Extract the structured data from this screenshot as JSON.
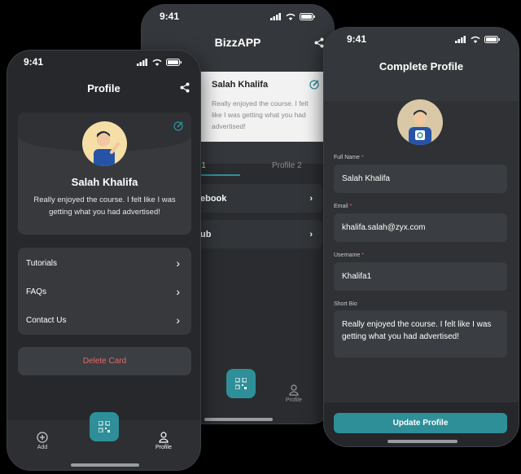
{
  "phone_left": {
    "time": "9:41",
    "title": "Profile",
    "name": "Salah Khalifa",
    "bio": "Really enjoyed the course. I felt like I was getting what you had advertised!",
    "menu": [
      "Tutorials",
      "FAQs",
      "Contact Us"
    ],
    "delete_label": "Delete Card",
    "nav_add": "Add",
    "nav_profile": "Profile"
  },
  "phone_middle": {
    "time": "9:41",
    "title": "BizzAPP",
    "card_name": "Salah Khalifa",
    "card_bio": "Really enjoyed the course. I felt like I was getting what you had advertised!",
    "tab1": "e 1",
    "tab2": "Profile 2",
    "row1": "ebook",
    "row2": "ub",
    "nav_profile": "Profile"
  },
  "phone_right": {
    "time": "9:41",
    "title": "Complete Profile",
    "fields": {
      "full_name_label": "Full Name",
      "full_name": "Salah Khalifa",
      "email_label": "Email",
      "email": "khalifa.salah@zyx.com",
      "username_label": "Username",
      "username": "Khalifa1",
      "bio_label": "Short Bio",
      "bio": "Really enjoyed the course. I felt like I was getting what you had advertised!"
    },
    "required_mark": "*",
    "update_label": "Update Profile"
  },
  "colors": {
    "accent": "#2e8f99",
    "danger": "#e56a6a",
    "background": "#26282b"
  },
  "icons": [
    "share-icon",
    "edit-icon",
    "chevron-right-icon",
    "qr-icon",
    "plus-circle-icon",
    "person-icon",
    "signal-icon",
    "wifi-icon",
    "battery-icon"
  ]
}
